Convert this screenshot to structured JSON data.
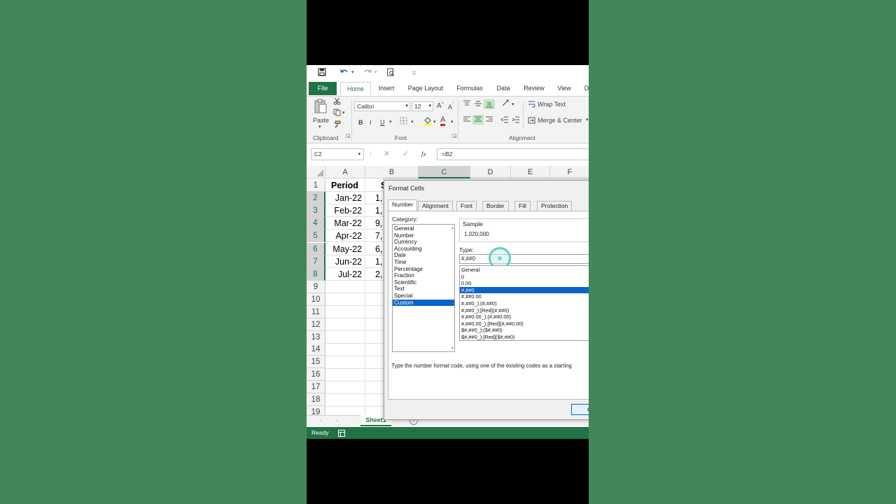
{
  "qat": {
    "more_label": "="
  },
  "ribbon_tabs": [
    "File",
    "Home",
    "Insert",
    "Page Layout",
    "Formulas",
    "Data",
    "Review",
    "View",
    "D"
  ],
  "ribbon": {
    "clipboard": {
      "paste_label": "Paste",
      "group_label": "Clipboard"
    },
    "font": {
      "font_name": "Calibri",
      "font_size": "12",
      "bold": "B",
      "italic": "I",
      "underline": "U",
      "grow": "A",
      "shrink": "A",
      "font_color": "A",
      "group_label": "Font"
    },
    "alignment": {
      "wrap_text": "Wrap Text",
      "merge_center": "Merge & Center",
      "group_label": "Alignment"
    }
  },
  "formula_bar": {
    "name_box": "C2",
    "fx": "fx",
    "formula": "=B2"
  },
  "sheet": {
    "columns": [
      "A",
      "B",
      "C",
      "D",
      "E",
      "F"
    ],
    "selected_column": "C",
    "rows": [
      "1",
      "2",
      "3",
      "4",
      "5",
      "6",
      "7",
      "8",
      "9",
      "10",
      "11",
      "12",
      "13",
      "14",
      "15",
      "16",
      "17",
      "18",
      "19"
    ],
    "header_cell": "Period",
    "col_b_header": "S",
    "periods": [
      "Jan-22",
      "Feb-22",
      "Mar-22",
      "Apr-22",
      "May-22",
      "Jun-22",
      "Jul-22"
    ],
    "col_b_values": [
      "1,",
      "1,",
      "9,",
      "7,",
      "6,",
      "1,",
      "2,"
    ]
  },
  "sheet_tabs": {
    "active": "Sheet1",
    "add": "+"
  },
  "status": {
    "text": "Ready"
  },
  "dialog": {
    "title": "Format Cells",
    "tabs": [
      "Number",
      "Alignment",
      "Font",
      "Border",
      "Fill",
      "Protection"
    ],
    "category_label": "Category:",
    "categories": [
      "General",
      "Number",
      "Currency",
      "Accounting",
      "Date",
      "Time",
      "Percentage",
      "Fraction",
      "Scientific",
      "Text",
      "Special",
      "Custom"
    ],
    "selected_category": "Custom",
    "sample_label": "Sample",
    "sample_value": "1,020,000",
    "type_label": "Type:",
    "type_value": "#,##0",
    "formats": [
      "General",
      "0",
      "0.00",
      "#,##0",
      "#,##0.00",
      "#,##0_);(#,##0)",
      "#,##0_);[Red](#,##0)",
      "#,##0.00_);(#,##0.00)",
      "#,##0.00_);[Red](#,##0.00)",
      "$#,##0_);($#,##0)",
      "$#,##0_);[Red]($#,##0)"
    ],
    "selected_format": "#,##0",
    "hint": "Type the number format code, using one of the existing codes as a starting",
    "ok_label": "O"
  },
  "colors": {
    "excel_green": "#217346",
    "selection_blue": "#0a64c8",
    "background": "#43865a"
  }
}
